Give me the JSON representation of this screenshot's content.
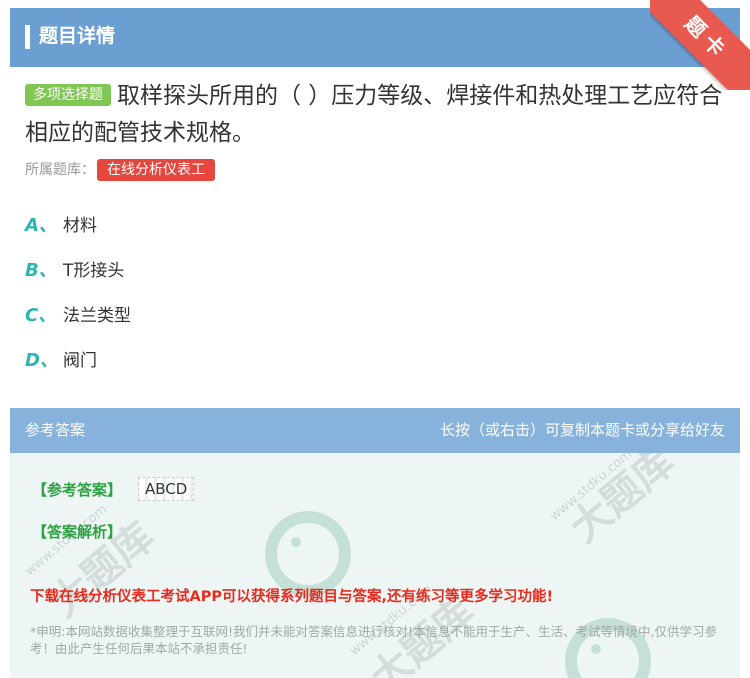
{
  "header": {
    "title": "题目详情",
    "ribbon": "题卡"
  },
  "question": {
    "type_badge": "多项选择题",
    "text": "取样探头所用的（ ）压力等级、焊接件和热处理工艺应符合相应的配管技术规格。",
    "bank_label": "所属题库：",
    "bank_name": "在线分析仪表工"
  },
  "options": [
    {
      "letter": "A、",
      "text": "材料"
    },
    {
      "letter": "B、",
      "text": "T形接头"
    },
    {
      "letter": "C、",
      "text": "法兰类型"
    },
    {
      "letter": "D、",
      "text": "阀门"
    }
  ],
  "answer": {
    "header_left": "参考答案",
    "header_right": "长按（或右击）可复制本题卡或分享给好友",
    "ref_label": "【参考答案】",
    "ref_value": "ABCD",
    "analysis_label": "【答案解析】",
    "promo": "下载在线分析仪表工考试APP可以获得系列题目与答案,还有练习等更多学习功能!",
    "disclaimer": "*申明:本网站数据收集整理于互联网!我们并未能对答案信息进行核对!本信息不能用于生产、生活、考试等情境中,仅供学习参考！由此产生任何后果本站不承担责任!"
  },
  "watermark": {
    "brand": "大题库",
    "site": "www.stdku.com"
  },
  "colors": {
    "header": "#6b9fd2",
    "answer_header": "#86b2dc",
    "accent_green": "#2fa043",
    "badge_red": "#e5473f",
    "option_teal": "#2fb4b0"
  }
}
